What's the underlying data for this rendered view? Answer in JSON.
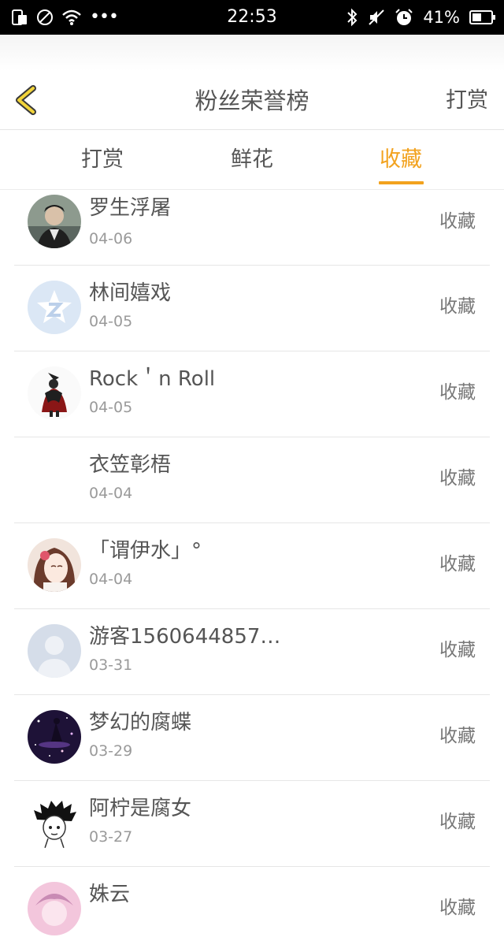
{
  "status_bar": {
    "time": "22:53",
    "battery": "41%",
    "icons": [
      "sim-icon",
      "no-disturb-icon",
      "wifi-icon",
      "more-dots-icon",
      "bluetooth-icon",
      "mute-icon",
      "alarm-icon",
      "battery-icon"
    ]
  },
  "header": {
    "title": "粉丝荣誉榜",
    "action_label": "打赏",
    "back_icon": "chevron-left-icon",
    "accent_color": "#f2a21e"
  },
  "tabs": [
    {
      "label": "打赏",
      "active": false
    },
    {
      "label": "鲜花",
      "active": false
    },
    {
      "label": "收藏",
      "active": true
    }
  ],
  "list": [
    {
      "name": "罗生浮屠",
      "date": "04-06",
      "action": "收藏",
      "avatar": "photo-avatar"
    },
    {
      "name": "林间嬉戏",
      "date": "04-05",
      "action": "收藏",
      "avatar": "qq-default-avatar"
    },
    {
      "name": "Rock＇n Roll",
      "date": "04-05",
      "action": "收藏",
      "avatar": "figure-avatar"
    },
    {
      "name": "衣笠彰梧",
      "date": "04-04",
      "action": "收藏",
      "avatar": "empty-avatar"
    },
    {
      "name": "「谓伊水」°",
      "date": "04-04",
      "action": "收藏",
      "avatar": "anime-girl-avatar"
    },
    {
      "name": "游客1560644857…",
      "date": "03-31",
      "action": "收藏",
      "avatar": "default-person-avatar"
    },
    {
      "name": "梦幻的腐蝶",
      "date": "03-29",
      "action": "收藏",
      "avatar": "night-sky-avatar"
    },
    {
      "name": "阿柠是腐女",
      "date": "03-27",
      "action": "收藏",
      "avatar": "sketch-avatar"
    },
    {
      "name": "姝云",
      "date": "",
      "action": "收藏",
      "avatar": "pink-avatar"
    }
  ]
}
